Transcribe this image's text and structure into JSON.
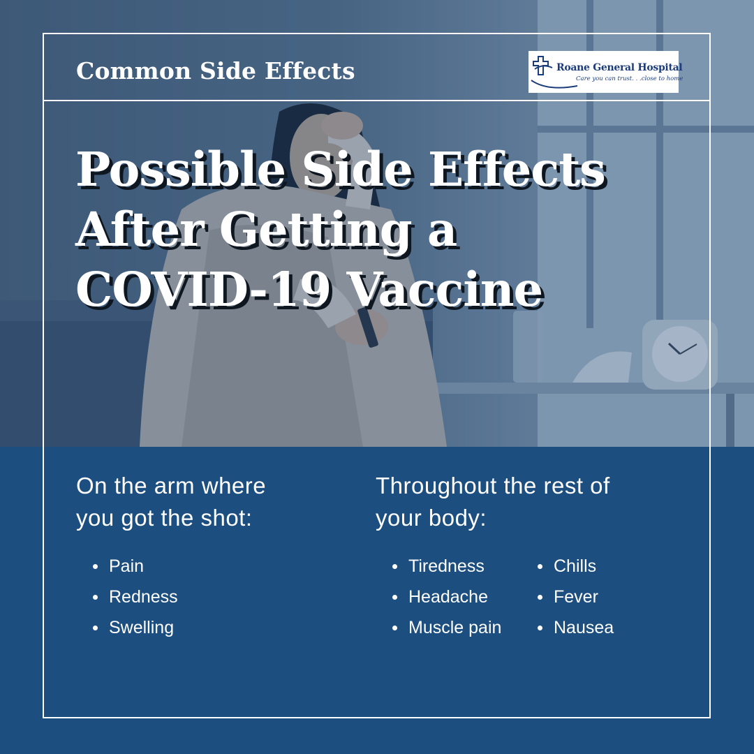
{
  "header": {
    "title": "Common Side Effects"
  },
  "logo": {
    "name": "Roane General Hospital",
    "tagline": "Care you can trust. . .close to home"
  },
  "headline": {
    "lines": [
      "Possible Side Effects",
      "After Getting a",
      "COVID-19 Vaccine"
    ]
  },
  "arm_section": {
    "heading_lines": [
      "On the arm where",
      "you got the shot:"
    ],
    "items": [
      "Pain",
      "Redness",
      "Swelling"
    ]
  },
  "body_section": {
    "heading_lines": [
      "Throughout the rest of",
      "your body:"
    ],
    "items_col1": [
      "Tiredness",
      "Headache",
      "Muscle pain"
    ],
    "items_col2": [
      "Chills",
      "Fever",
      "Nausea"
    ]
  },
  "colors": {
    "panel_blue": "#1c4e80",
    "logo_blue": "#1b3c7a",
    "text": "#ffffff"
  }
}
